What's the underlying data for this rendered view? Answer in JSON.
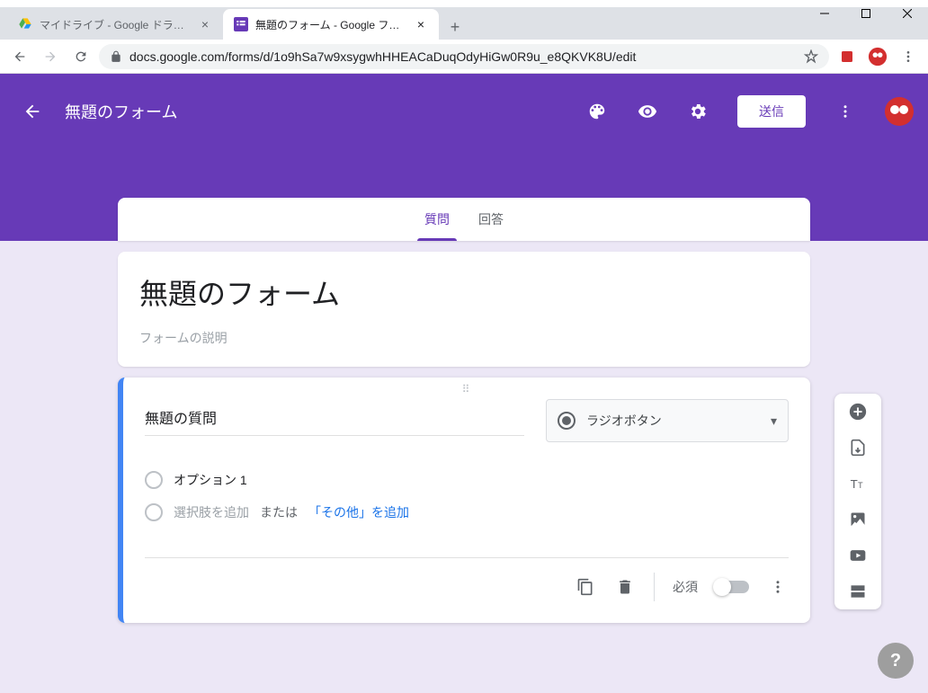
{
  "window": {
    "tabs": [
      {
        "title": "マイドライブ - Google ドライブ",
        "active": false
      },
      {
        "title": "無題のフォーム - Google フォーム",
        "active": true
      }
    ],
    "url": "docs.google.com/forms/d/1o9hSa7w9xsygwhHHEACaDuqOdyHiGw0R9u_e8QKVK8U/edit"
  },
  "header": {
    "title": "無題のフォーム",
    "send_label": "送信"
  },
  "tabs": {
    "questions": "質問",
    "responses": "回答"
  },
  "form": {
    "title": "無題のフォーム",
    "description_placeholder": "フォームの説明"
  },
  "question": {
    "title": "無題の質問",
    "type_label": "ラジオボタン",
    "options": [
      {
        "label": "オプション 1"
      }
    ],
    "add_option_label": "選択肢を追加",
    "or_label": "または",
    "add_other_label": "「その他」を追加",
    "required_label": "必須"
  }
}
